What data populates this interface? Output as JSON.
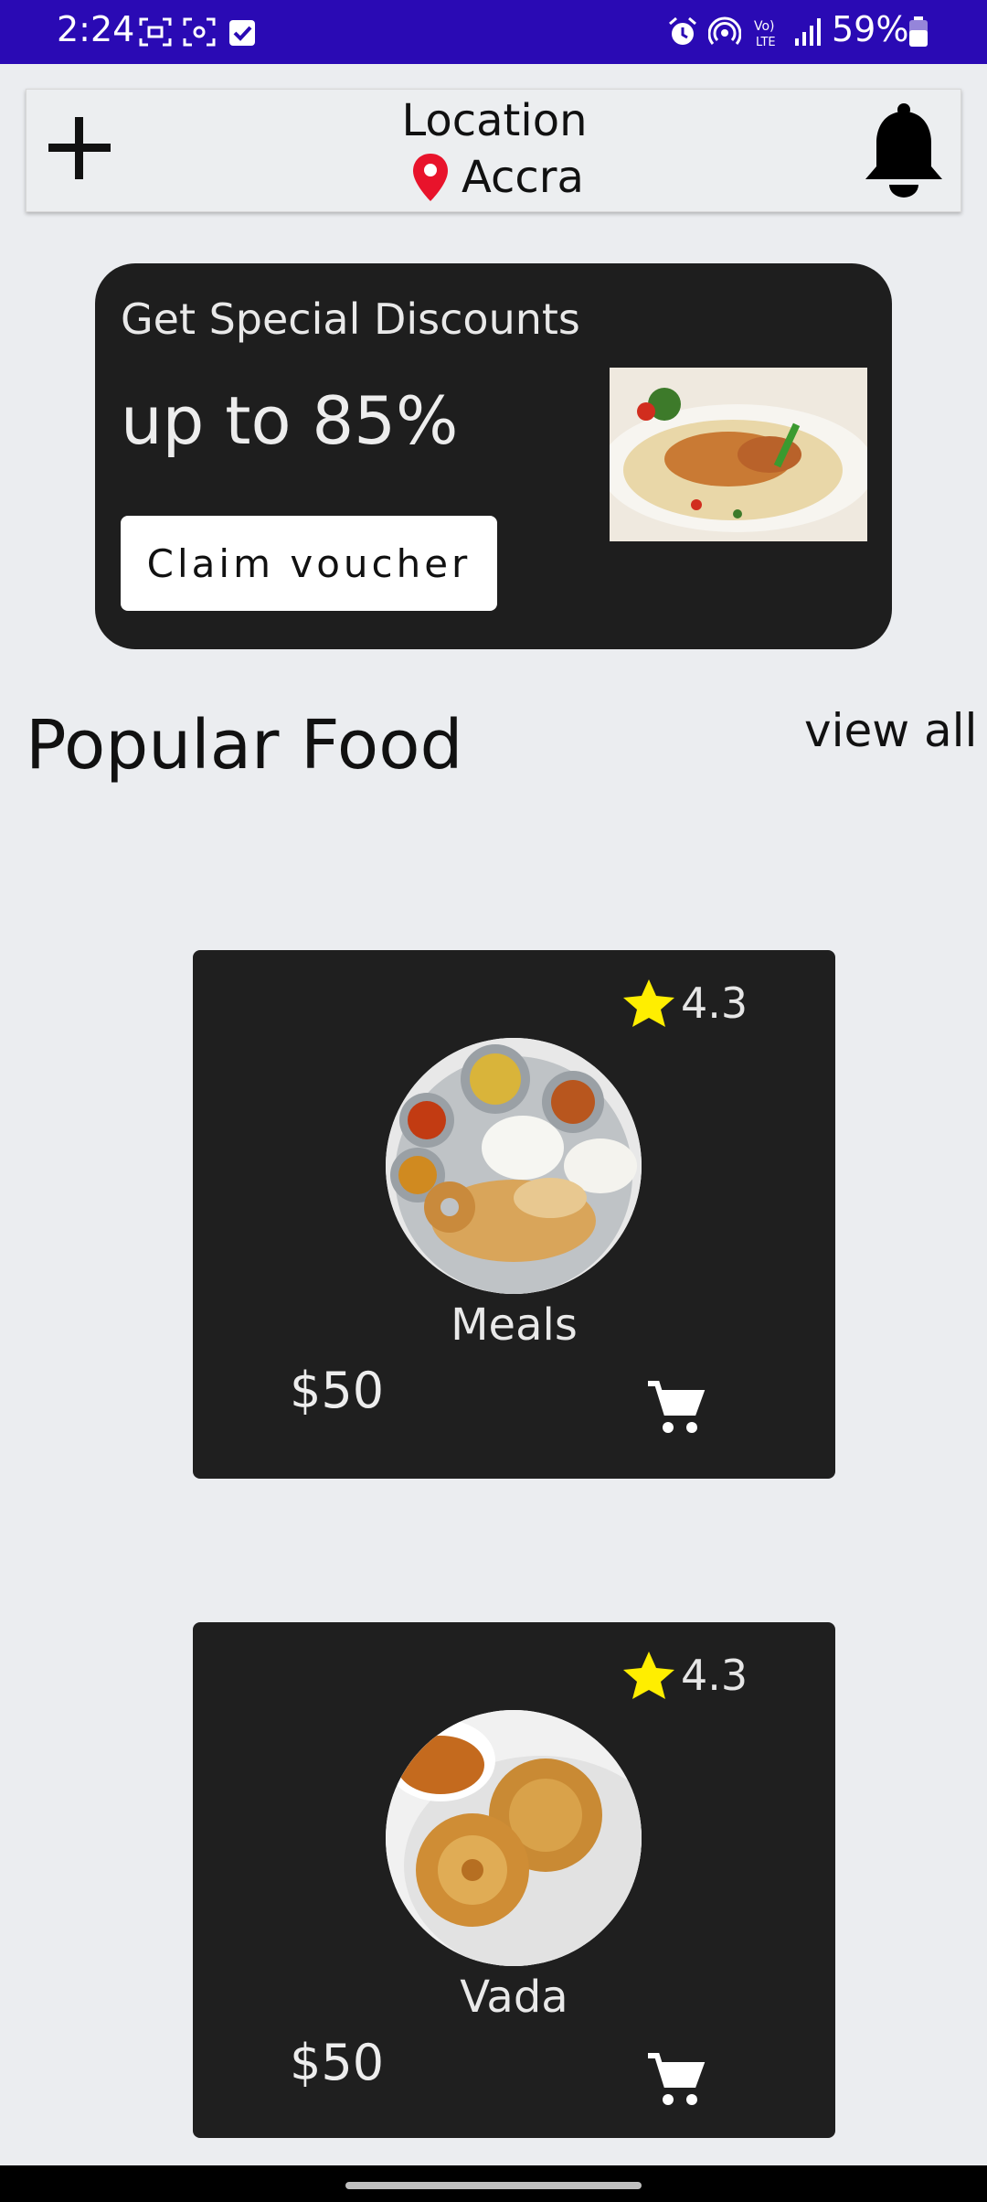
{
  "status_bar": {
    "time": "2:24",
    "battery": "59%"
  },
  "header": {
    "location_title": "Location",
    "city": "Accra"
  },
  "promo": {
    "title": "Get Special Discounts",
    "discount": "up to 85%",
    "button_label": "Claim voucher"
  },
  "section": {
    "title": "Popular Food",
    "view_all": "view all"
  },
  "foods": [
    {
      "name": "Meals",
      "price": "$50",
      "rating": "4.3"
    },
    {
      "name": "Vada",
      "price": "$50",
      "rating": "4.3"
    }
  ],
  "colors": {
    "status_bar": "#2a0ab4",
    "card": "#1e1e1e",
    "star": "#ffee00",
    "pin": "#e8132b"
  }
}
